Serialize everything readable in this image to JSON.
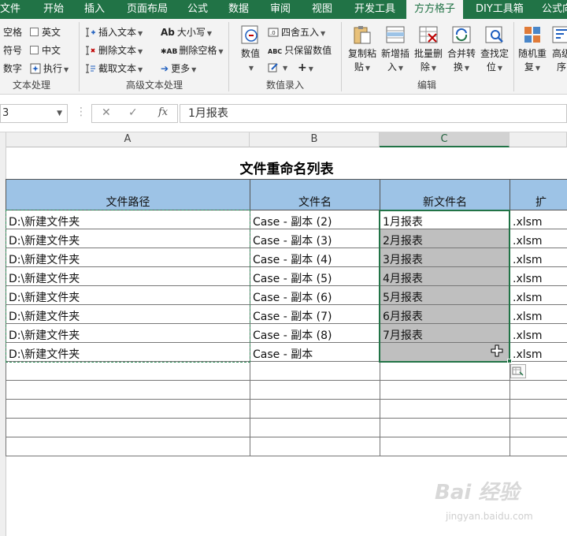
{
  "tabs": [
    "文件",
    "开始",
    "插入",
    "页面布局",
    "公式",
    "数据",
    "审阅",
    "视图",
    "开发工具",
    "方方格子",
    "DIY工具箱",
    "公式向"
  ],
  "active_tab": "方方格子",
  "ribbon": {
    "text_group": {
      "items": [
        "空格",
        "英文",
        "符号",
        "中文",
        "数字",
        "执行"
      ],
      "label": "文本处理"
    },
    "advanced_group": {
      "items": [
        "插入文本",
        "删除文本",
        "截取文本",
        "大小写",
        "删除空格",
        "更多"
      ],
      "label": "高级文本处理"
    },
    "numeric_group": {
      "numeric_label": "数值",
      "round_label": "四舍五入",
      "keep_label": "只保留数值",
      "label": "数值录入"
    },
    "edit_group": {
      "buttons": [
        "复制粘\n贴",
        "新增插\n入",
        "批量删\n除",
        "合并转\n换",
        "查找定\n位"
      ],
      "label": "编辑"
    },
    "random_group": {
      "buttons": [
        "随机重\n复",
        "高级\n序"
      ]
    }
  },
  "formula_bar": {
    "name_box": "3",
    "cancel_icon": "✕",
    "enter_icon": "✓",
    "fx_label": "fx",
    "value": "1月报表"
  },
  "columns": [
    "A",
    "B",
    "C"
  ],
  "sheet": {
    "title": "文件重命名列表",
    "headers": [
      "文件路径",
      "文件名",
      "新文件名",
      "扩"
    ],
    "rows": [
      [
        "D:\\新建文件夹",
        "Case - 副本 (2)",
        "1月报表",
        ".xlsm"
      ],
      [
        "D:\\新建文件夹",
        "Case - 副本 (3)",
        "2月报表",
        ".xlsm"
      ],
      [
        "D:\\新建文件夹",
        "Case - 副本 (4)",
        "3月报表",
        ".xlsm"
      ],
      [
        "D:\\新建文件夹",
        "Case - 副本 (5)",
        "4月报表",
        ".xlsm"
      ],
      [
        "D:\\新建文件夹",
        "Case - 副本 (6)",
        "5月报表",
        ".xlsm"
      ],
      [
        "D:\\新建文件夹",
        "Case - 副本 (7)",
        "6月报表",
        ".xlsm"
      ],
      [
        "D:\\新建文件夹",
        "Case - 副本 (8)",
        "7月报表",
        ".xlsm"
      ],
      [
        "D:\\新建文件夹",
        "Case - 副本",
        "",
        ".xlsm"
      ]
    ]
  },
  "watermark": {
    "main": "Bai 经验",
    "sub": "jingyan.baidu.com"
  },
  "colors": {
    "ribbon_green": "#217346",
    "header_fill": "#9dc3e6",
    "selection_fill": "#bfbfbf"
  }
}
